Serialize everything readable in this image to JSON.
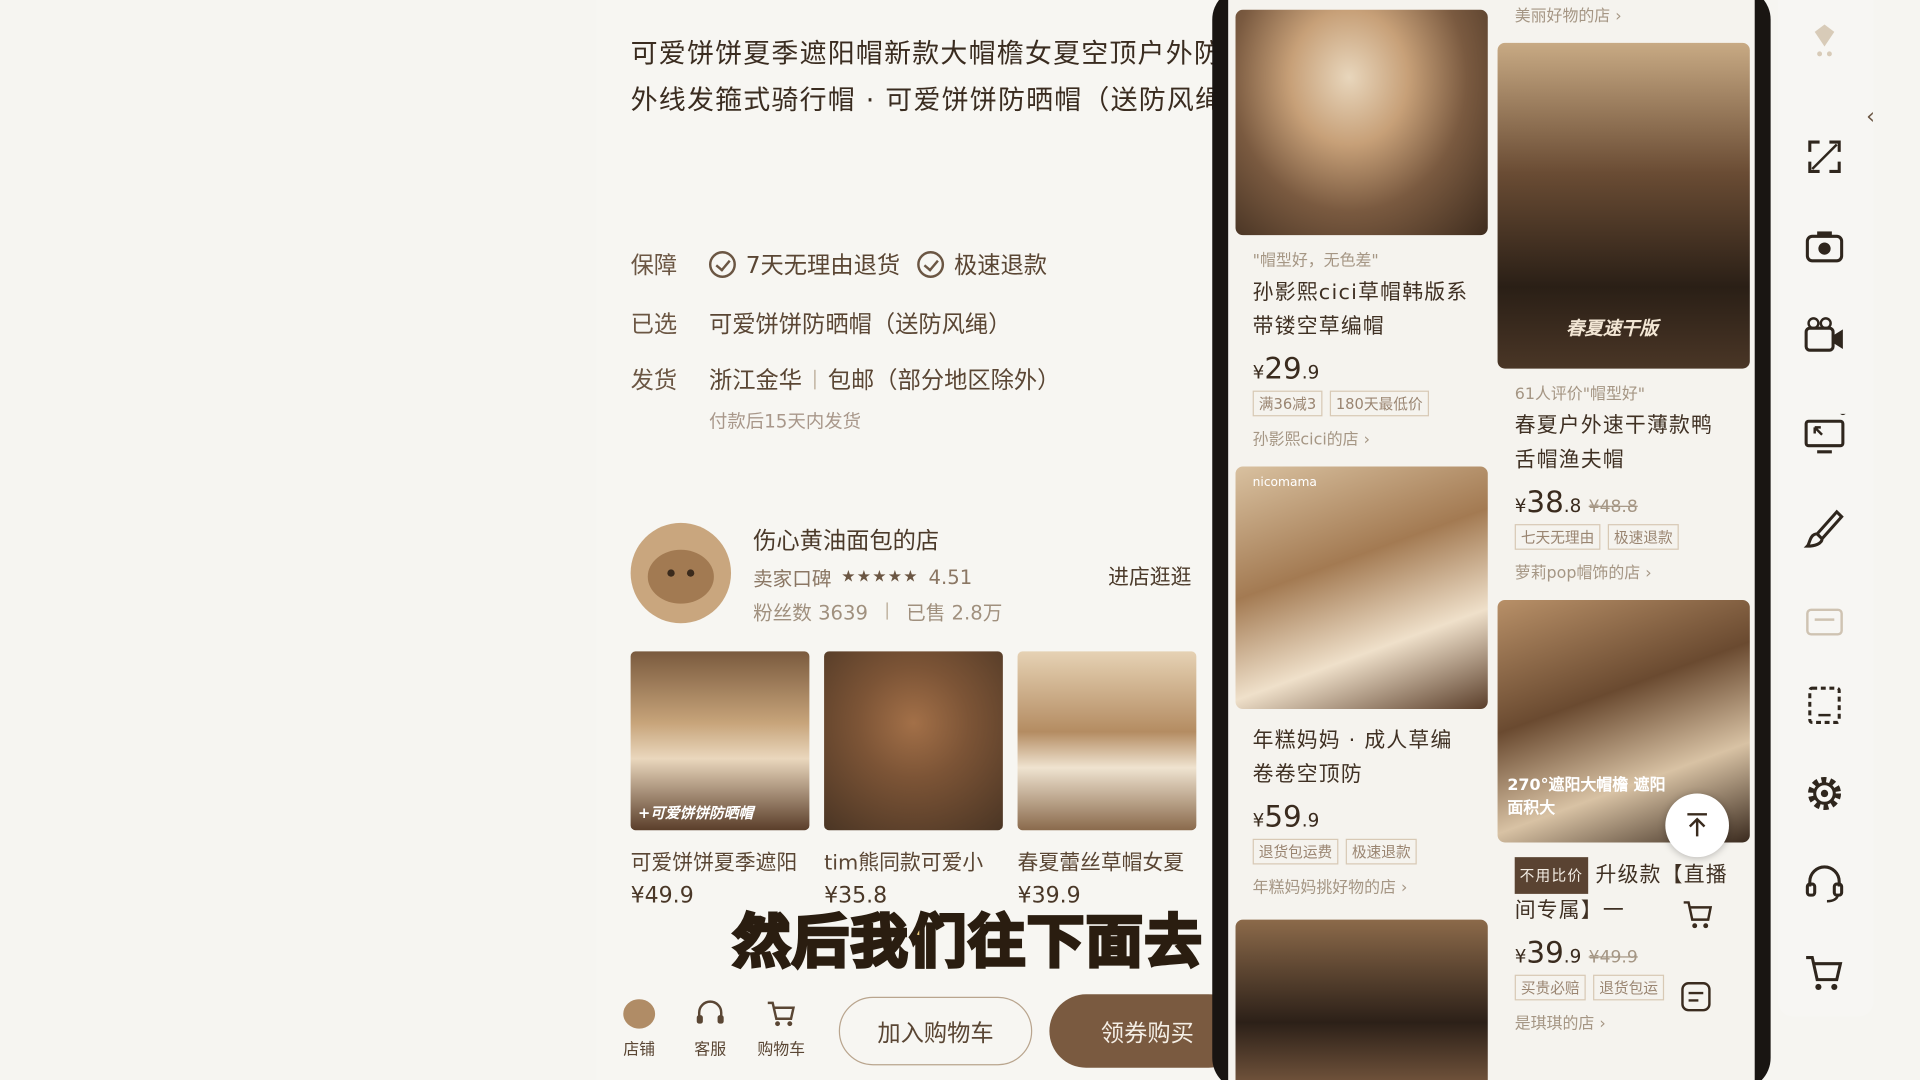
{
  "product": {
    "title": "可爱饼饼夏季遮阳帽新款大帽檐女夏空顶户外防紫外线发箍式骑行帽 · 可爱饼饼防晒帽（送防风绳）",
    "guarantee_label": "保障",
    "guarantees": [
      "7天无理由退货",
      "极速退款"
    ],
    "selected_label": "已选",
    "selected_value": "可爱饼饼防晒帽（送防风绳）",
    "ship_label": "发货",
    "ship_from": "浙江金华",
    "ship_free": "包邮（部分地区除外）",
    "ship_note": "付款后15天内发货"
  },
  "store": {
    "name": "伤心黄油面包的店",
    "rating_label": "卖家口碑",
    "rating": "4.51",
    "fans": "粉丝数 3639",
    "sold": "已售 2.8万",
    "enter": "进店逛逛"
  },
  "related": [
    {
      "name": "可爱饼饼夏季遮阳",
      "price": "¥49.9",
      "tag": "+可爱饼饼防晒帽"
    },
    {
      "name": "tim熊同款可爱小",
      "price": "¥35.8",
      "tag": ""
    },
    {
      "name": "春夏蕾丝草帽女夏",
      "price": "¥39.9",
      "tag": ""
    }
  ],
  "caption": "然后我们往下面去",
  "bottom_bar": {
    "store": "店铺",
    "service": "客服",
    "cart": "购物车",
    "add_cart": "加入购物车",
    "buy": "领券购买"
  },
  "feed": {
    "top_shop": "美丽好物的店 ›",
    "left": [
      {
        "quote": "\"帽型好，无色差\"",
        "title": "孙影熙cici草帽韩版系带镂空草编帽",
        "price_int": "29",
        "price_dec": ".9",
        "orig": "",
        "tags": [
          "满36减3",
          "180天最低价"
        ],
        "shop": "孙影熙cici的店 ›",
        "badge": "",
        "img_tag": ""
      },
      {
        "quote": "",
        "title": "年糕妈妈 · 成人草编卷卷空顶防",
        "price_int": "59",
        "price_dec": ".9",
        "orig": "",
        "tags": [
          "退货包运费",
          "极速退款"
        ],
        "shop": "年糕妈妈挑好物的店 ›",
        "badge": "",
        "img_tag": "nicomama"
      }
    ],
    "right": [
      {
        "quote": "61人评价\"帽型好\"",
        "title": "春夏户外速干薄款鸭舌帽渔夫帽",
        "price_int": "38",
        "price_dec": ".8",
        "orig": "¥48.8",
        "tags": [
          "七天无理由",
          "极速退款"
        ],
        "shop": "萝莉pop帽饰的店 ›",
        "badge": "",
        "img_tag": "春夏速干版"
      },
      {
        "quote": "",
        "title": "升级款【直播间专属】一",
        "price_int": "39",
        "price_dec": ".9",
        "orig": "¥49.9",
        "tags": [
          "买贵必赔",
          "退货包运"
        ],
        "shop": "是琪琪的店 ›",
        "badge": "不用比价",
        "img_tag": "270°遮阳大帽檐 遮阳面积大"
      }
    ]
  },
  "colors": {
    "accent": "#7a5a40",
    "text": "#3b2e22",
    "muted": "#a59684"
  }
}
